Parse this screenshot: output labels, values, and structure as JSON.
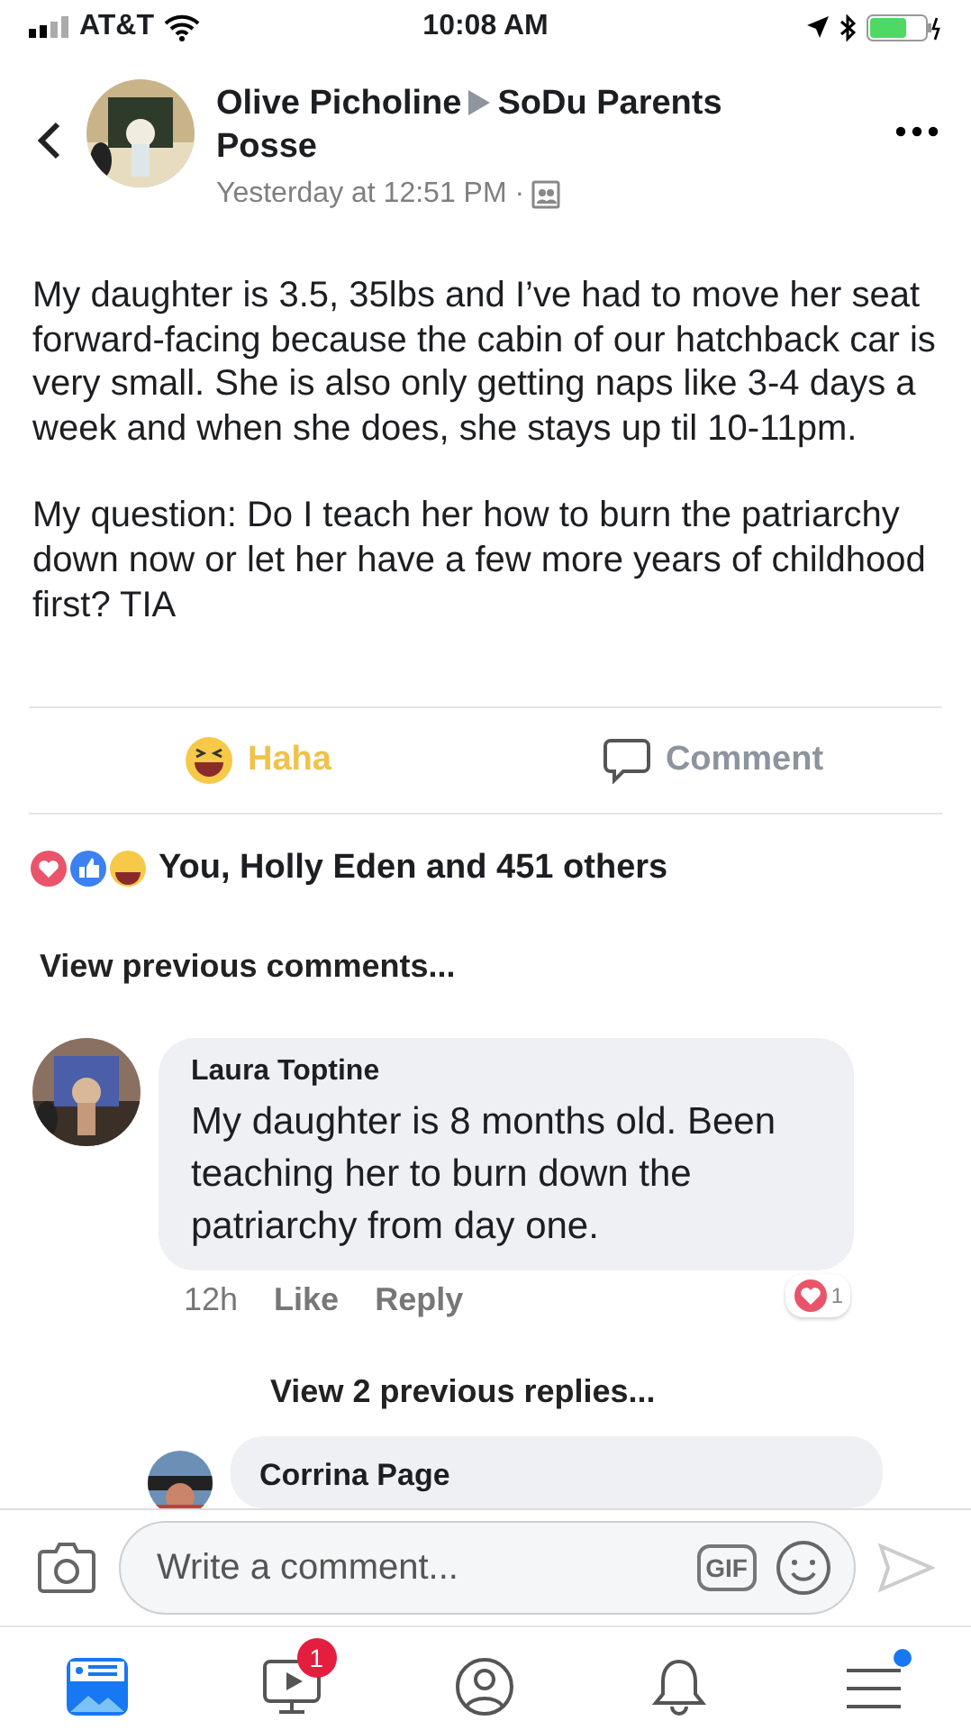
{
  "status_bar": {
    "carrier": "AT&T",
    "time": "10:08 AM"
  },
  "post": {
    "author": "Olive Picholine",
    "group": "SoDu Parents Posse",
    "timestamp": "Yesterday at 12:51 PM · ",
    "paragraphs": [
      "My daughter is 3.5, 35lbs and I’ve had to move her seat forward-facing because the cabin of our hatchback car is very small. She is also only getting naps like 3-4 days a week and when she does, she stays up til 10-11pm.",
      "My question: Do I teach her how to burn the patriarchy down now or let her have a few more years of childhood first? TIA"
    ]
  },
  "actions": [
    {
      "kind": "haha",
      "label": "Haha",
      "selected": true
    },
    {
      "kind": "comment",
      "label": "Comment",
      "selected": false
    }
  ],
  "reactions_summary": "You, Holly Eden and 451 others",
  "view_previous": "View previous comments...",
  "comment": {
    "author": "Laura Toptine",
    "text": "My daughter is 8 months old.  Been teaching her to burn down the patriarchy from day one.",
    "time": "12h",
    "links": [
      "Like",
      "Reply"
    ],
    "reaction_count": "1"
  },
  "view_replies": "View 2 previous replies...",
  "reply": {
    "author": "Corrina Page"
  },
  "composer": {
    "placeholder": "Write a comment...",
    "gif_label": "GIF"
  },
  "tab_bar": [
    {
      "kind": "feed",
      "selected": true
    },
    {
      "kind": "video",
      "selected": false,
      "badge": "1"
    },
    {
      "kind": "profile",
      "selected": false
    },
    {
      "kind": "notifications",
      "selected": false
    },
    {
      "kind": "menu",
      "selected": false,
      "dot": true
    }
  ]
}
